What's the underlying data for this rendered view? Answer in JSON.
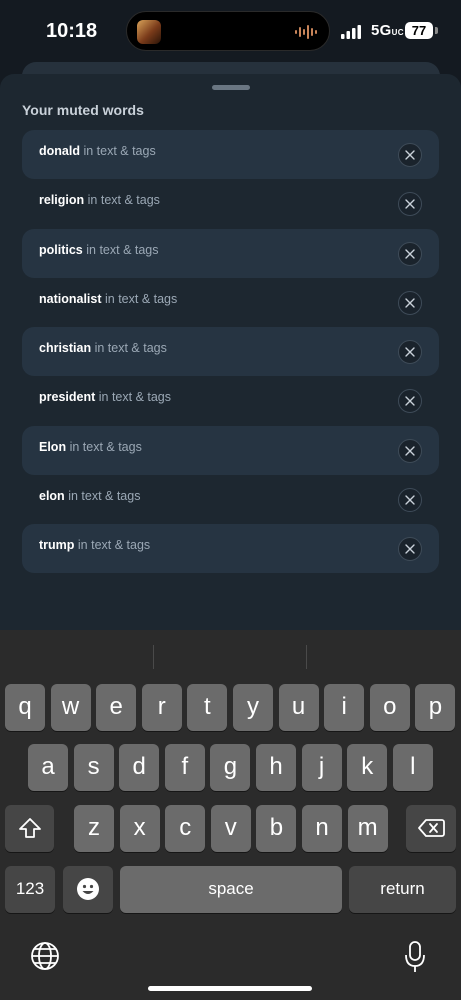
{
  "status_bar": {
    "time": "10:18",
    "network": "5G",
    "network_suffix": "UC",
    "battery": "77"
  },
  "section_title": "Your muted words",
  "muted_words": [
    {
      "word": "donald",
      "scope": "in text & tags"
    },
    {
      "word": "religion",
      "scope": "in text & tags"
    },
    {
      "word": "politics",
      "scope": "in text & tags"
    },
    {
      "word": "nationalist",
      "scope": "in text & tags"
    },
    {
      "word": "christian",
      "scope": "in text & tags"
    },
    {
      "word": "president",
      "scope": "in text & tags"
    },
    {
      "word": "Elon",
      "scope": "in text & tags"
    },
    {
      "word": "elon",
      "scope": "in text & tags"
    },
    {
      "word": "trump",
      "scope": "in text & tags"
    }
  ],
  "keyboard": {
    "row1": [
      "q",
      "w",
      "e",
      "r",
      "t",
      "y",
      "u",
      "i",
      "o",
      "p"
    ],
    "row2": [
      "a",
      "s",
      "d",
      "f",
      "g",
      "h",
      "j",
      "k",
      "l"
    ],
    "row3": [
      "z",
      "x",
      "c",
      "v",
      "b",
      "n",
      "m"
    ],
    "numbers_label": "123",
    "space_label": "space",
    "return_label": "return",
    "shift_icon": "shift-icon",
    "delete_icon": "delete-icon",
    "emoji_icon": "emoji-icon",
    "globe_icon": "globe-icon",
    "mic_icon": "microphone-icon"
  },
  "colors": {
    "sheet": "#1d2730",
    "row_shaded": "#263442",
    "key": "#6b6b6b",
    "key_function": "#464646"
  }
}
